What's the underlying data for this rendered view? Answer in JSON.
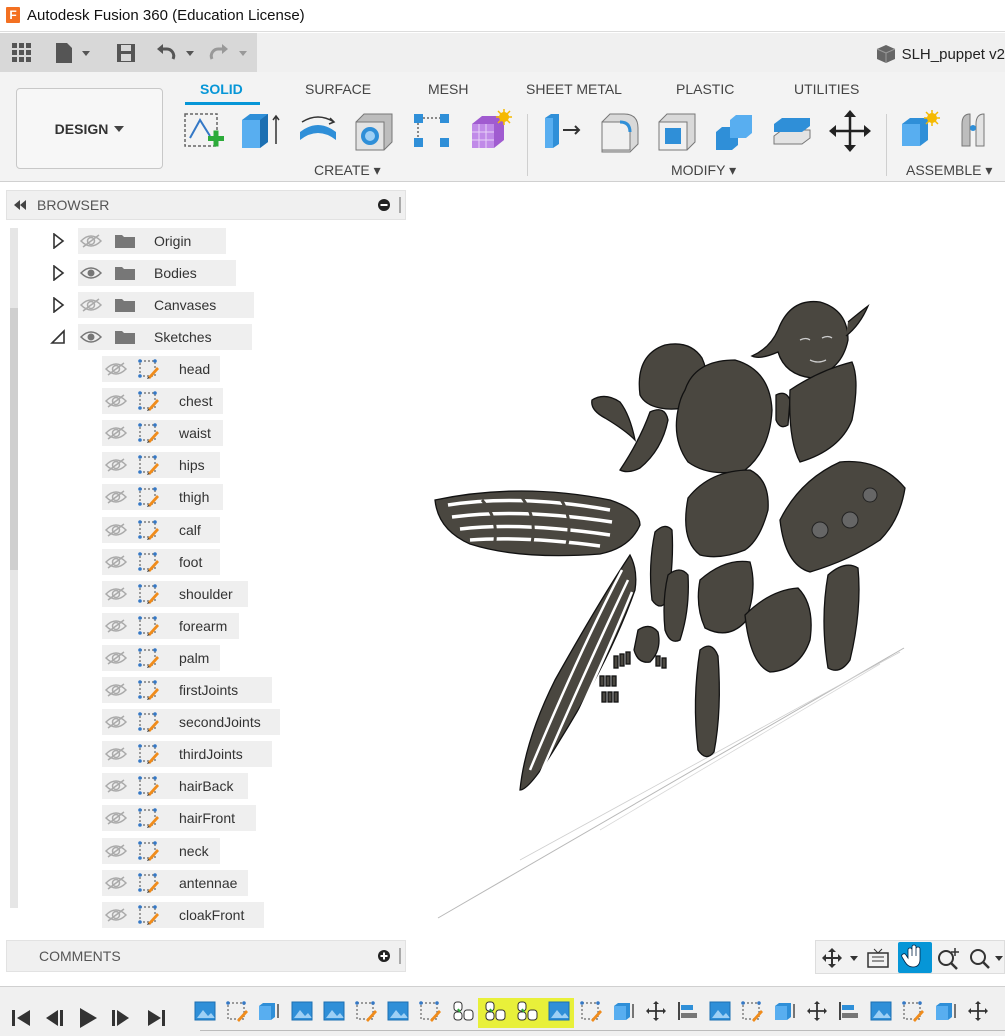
{
  "titlebar": {
    "title": "Autodesk Fusion 360 (Education License)",
    "logo_letter": "F"
  },
  "document": {
    "title": "SLH_puppet v2"
  },
  "workspace": {
    "label": "DESIGN"
  },
  "tabs": [
    {
      "label": "SOLID",
      "active": true
    },
    {
      "label": "SURFACE",
      "active": false
    },
    {
      "label": "MESH",
      "active": false
    },
    {
      "label": "SHEET METAL",
      "active": false
    },
    {
      "label": "PLASTIC",
      "active": false
    },
    {
      "label": "UTILITIES",
      "active": false
    }
  ],
  "groups": {
    "create": "CREATE",
    "modify": "MODIFY",
    "assemble": "ASSEMBLE"
  },
  "browser": {
    "title": "BROWSER",
    "folders": [
      {
        "label": "Origin",
        "visible": false,
        "expanded": false
      },
      {
        "label": "Bodies",
        "visible": true,
        "expanded": false
      },
      {
        "label": "Canvases",
        "visible": false,
        "expanded": false
      },
      {
        "label": "Sketches",
        "visible": true,
        "expanded": true
      }
    ],
    "sketches": [
      "head",
      "chest",
      "waist",
      "hips",
      "thigh",
      "calf",
      "foot",
      "shoulder",
      "forearm",
      "palm",
      "firstJoints",
      "secondJoints",
      "thirdJoints",
      "hairBack",
      "hairFront",
      "neck",
      "antennae",
      "cloakFront"
    ]
  },
  "comments": {
    "title": "COMMENTS"
  },
  "colors": {
    "accent": "#0696d7",
    "highlight": "#e8f03a",
    "part_fill": "#4a4740",
    "brand": "#f37021"
  }
}
